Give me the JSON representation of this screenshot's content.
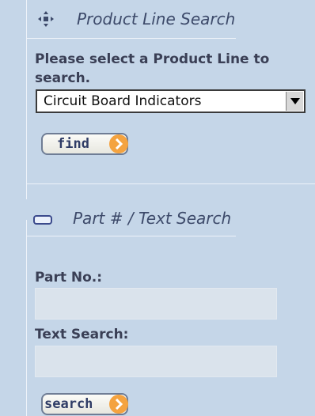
{
  "product_line": {
    "header": "Product Line Search",
    "prompt": "Please select a Product Line to search.",
    "selected": "Circuit Board Indicators",
    "find_label": "find"
  },
  "part_search": {
    "header": "Part # / Text Search",
    "part_no_label": "Part No.:",
    "part_no_value": "",
    "text_search_label": "Text Search:",
    "text_search_value": "",
    "search_label": "search"
  },
  "icons": {
    "product_header_icon": "move-icon",
    "part_header_icon": "collapse-icon",
    "dropdown_icon": "dropdown-arrow-icon",
    "button_icon": "chevron-right-icon"
  },
  "colors": {
    "background": "#c5d6e8",
    "accent": "#f4a340",
    "header_text": "#3d4a6a"
  }
}
